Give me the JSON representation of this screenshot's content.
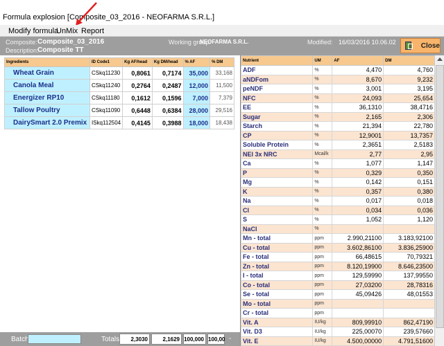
{
  "window": {
    "title": "Formula explosion  [Composite_03_2016 - NEOFARMA S.R.L.]"
  },
  "menu": {
    "items": [
      "Modify formula",
      "UnMix",
      "Report"
    ]
  },
  "header": {
    "composite_label": "Composite:",
    "composite_value": "Composite_03_2016",
    "description_label": "Description:",
    "description_value": "Composite TT",
    "group_label": "Working group:",
    "group_value": "NEOFARMA S.R.L.",
    "modified_label": "Modified:",
    "modified_value": "16/03/2016 10.06.02",
    "close_label": "Close"
  },
  "ingredients": {
    "headers": [
      "Ingredients",
      "ID Code1",
      "Kg AF/head",
      "Kg DM/head",
      "% AF",
      "% DM"
    ],
    "rows": [
      {
        "name": "Wheat Grain",
        "id": "CSkq11230",
        "kg_af": "0,8061",
        "kg_dm": "0,7174",
        "pct_af": "35,000",
        "pct_dm": "33,168"
      },
      {
        "name": "Canola Meal",
        "id": "CSkq11240",
        "kg_af": "0,2764",
        "kg_dm": "0,2487",
        "pct_af": "12,000",
        "pct_dm": "11,500"
      },
      {
        "name": "Energizer RP10",
        "id": "CSkq11180",
        "kg_af": "0,1612",
        "kg_dm": "0,1596",
        "pct_af": "7,000",
        "pct_dm": "7,379"
      },
      {
        "name": "Tallow Poultry",
        "id": "CSkq11090",
        "kg_af": "0,6448",
        "kg_dm": "0,6384",
        "pct_af": "28,000",
        "pct_dm": "29,516"
      },
      {
        "name": "DairySmart 2.0 Premix",
        "id": "ISkq112504",
        "kg_af": "0,4145",
        "kg_dm": "0,3988",
        "pct_af": "18,000",
        "pct_dm": "18,438"
      }
    ]
  },
  "nutrients": {
    "headers": [
      "Nutrient",
      "UM",
      "AF",
      "DM"
    ],
    "rows": [
      {
        "name": "ADF",
        "um": "%",
        "af": "4,470",
        "dm": "4,760"
      },
      {
        "name": "aNDFom",
        "um": "%",
        "af": "8,670",
        "dm": "9,232"
      },
      {
        "name": "peNDF",
        "um": "%",
        "af": "3,001",
        "dm": "3,195"
      },
      {
        "name": "NFC",
        "um": "%",
        "af": "24,093",
        "dm": "25,654"
      },
      {
        "name": "EE",
        "um": "%",
        "af": "36,1310",
        "dm": "38,4716"
      },
      {
        "name": "Sugar",
        "um": "%",
        "af": "2,165",
        "dm": "2,306"
      },
      {
        "name": "Starch",
        "um": "%",
        "af": "21,394",
        "dm": "22,780"
      },
      {
        "name": "CP",
        "um": "%",
        "af": "12,9001",
        "dm": "13,7357"
      },
      {
        "name": "Soluble Protein",
        "um": "%",
        "af": "2,3651",
        "dm": "2,5183"
      },
      {
        "name": "NEl 3x NRC",
        "um": "Mcal/k",
        "af": "2,77",
        "dm": "2,95"
      },
      {
        "name": "Ca",
        "um": "%",
        "af": "1,077",
        "dm": "1,147"
      },
      {
        "name": "P",
        "um": "%",
        "af": "0,329",
        "dm": "0,350"
      },
      {
        "name": "Mg",
        "um": "%",
        "af": "0,142",
        "dm": "0,151"
      },
      {
        "name": "K",
        "um": "%",
        "af": "0,357",
        "dm": "0,380"
      },
      {
        "name": "Na",
        "um": "%",
        "af": "0,017",
        "dm": "0,018"
      },
      {
        "name": "Cl",
        "um": "%",
        "af": "0,034",
        "dm": "0,036"
      },
      {
        "name": "S",
        "um": "%",
        "af": "1,052",
        "dm": "1,120"
      },
      {
        "name": "NaCl",
        "um": "%",
        "af": "",
        "dm": ""
      },
      {
        "name": "Mn - total",
        "um": "ppm",
        "af": "2.990,21100",
        "dm": "3.183,92100"
      },
      {
        "name": "Cu - total",
        "um": "ppm",
        "af": "3.602,86100",
        "dm": "3.836,25900"
      },
      {
        "name": "Fe - total",
        "um": "ppm",
        "af": "66,48615",
        "dm": "70,79321"
      },
      {
        "name": "Zn - total",
        "um": "ppm",
        "af": "8.120,19900",
        "dm": "8.646,23500"
      },
      {
        "name": "I - total",
        "um": "ppm",
        "af": "129,59990",
        "dm": "137,99550"
      },
      {
        "name": "Co - total",
        "um": "ppm",
        "af": "27,03200",
        "dm": "28,78316"
      },
      {
        "name": "Se - total",
        "um": "ppm",
        "af": "45,09426",
        "dm": "48,01553"
      },
      {
        "name": "Mo - total",
        "um": "ppm",
        "af": "",
        "dm": ""
      },
      {
        "name": "Cr - total",
        "um": "ppm",
        "af": "",
        "dm": ""
      },
      {
        "name": "Vit. A",
        "um": "IU/kg",
        "af": "809,99910",
        "dm": "862,47190"
      },
      {
        "name": "Vit. D3",
        "um": "IU/kg",
        "af": "225,00070",
        "dm": "239,57660"
      },
      {
        "name": "Vit. E",
        "um": "IU/kg",
        "af": "4.500,00000",
        "dm": "4.791,51600"
      }
    ]
  },
  "footer": {
    "batch_label": "Batch",
    "totals_label": "Totals",
    "totals": [
      "2,3030",
      "2,1629",
      "100,000",
      "100,00"
    ],
    "dash": "-"
  },
  "colors": {
    "accent": "#f7c98f",
    "selected": "#bff0ff",
    "header_bar": "#9e9e9e",
    "row_alt": "#fbe4d0",
    "arrow": "#e02020"
  }
}
